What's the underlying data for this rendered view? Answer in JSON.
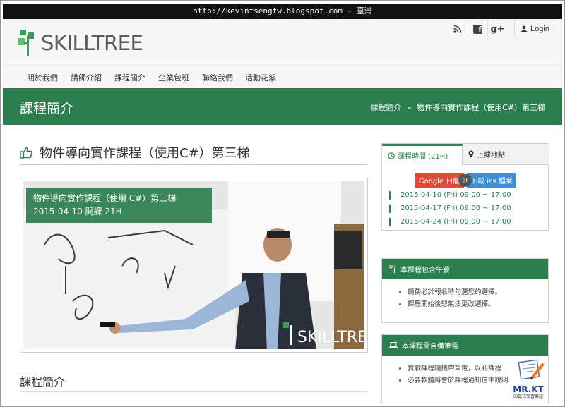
{
  "top_url": "http://kevintsengtw.blogspot.com - 臺灣",
  "header": {
    "logo_text": "SKILLTREE",
    "social": {
      "rss": "rss-icon",
      "facebook": "f",
      "google_plus": "g+"
    },
    "login_label": "Login"
  },
  "nav": {
    "items": [
      "關於我們",
      "講師介紹",
      "課程簡介",
      "企業包班",
      "聯絡我們",
      "活動花絮"
    ]
  },
  "banner": {
    "title": "課程簡介",
    "breadcrumb_parent": "課程簡介",
    "breadcrumb_sep": "»",
    "breadcrumb_current": "物件導向實作課程（使用C#）第三梯"
  },
  "course": {
    "title": "物件導向實作課程（使用C#）第三梯",
    "photo_caption_line1": "物件導向實作課程（使用 C#）第三梯",
    "photo_caption_line2": "2015-04-10 開課 21H",
    "photo_watermark": "SKILLTREE",
    "section_title": "課程簡介"
  },
  "sidebar": {
    "tab_time": "課程時間 (21H)",
    "tab_place": "上課地點",
    "google_btn": "Google 日曆",
    "or_label": "or",
    "ics_btn": "下載 ics 檔案",
    "dates": [
      "2015-04-10 (Fri) 09:00 ~ 17:00",
      "2015-04-17 (Fri) 09:00 ~ 17:00",
      "2015-04-24 (Fri) 09:00 ~ 17:00"
    ],
    "lunch_title": "本課程包含午餐",
    "lunch_items": [
      "請務必於報名時勾選您的選擇。",
      "課程開始後恕無法更改選擇。"
    ],
    "laptop_title": "本課程需自備筆電",
    "laptop_items": [
      "實戰課程請攜帶筆電，以利課程",
      "必要軟體將會於課程通知信中說明"
    ]
  },
  "stamp": {
    "name": "MR.KT",
    "sub": "的電式學習筆記"
  },
  "colors": {
    "brand_green": "#2d7e4f",
    "google_red": "#dd4b39",
    "ics_blue": "#3a8fd6"
  }
}
